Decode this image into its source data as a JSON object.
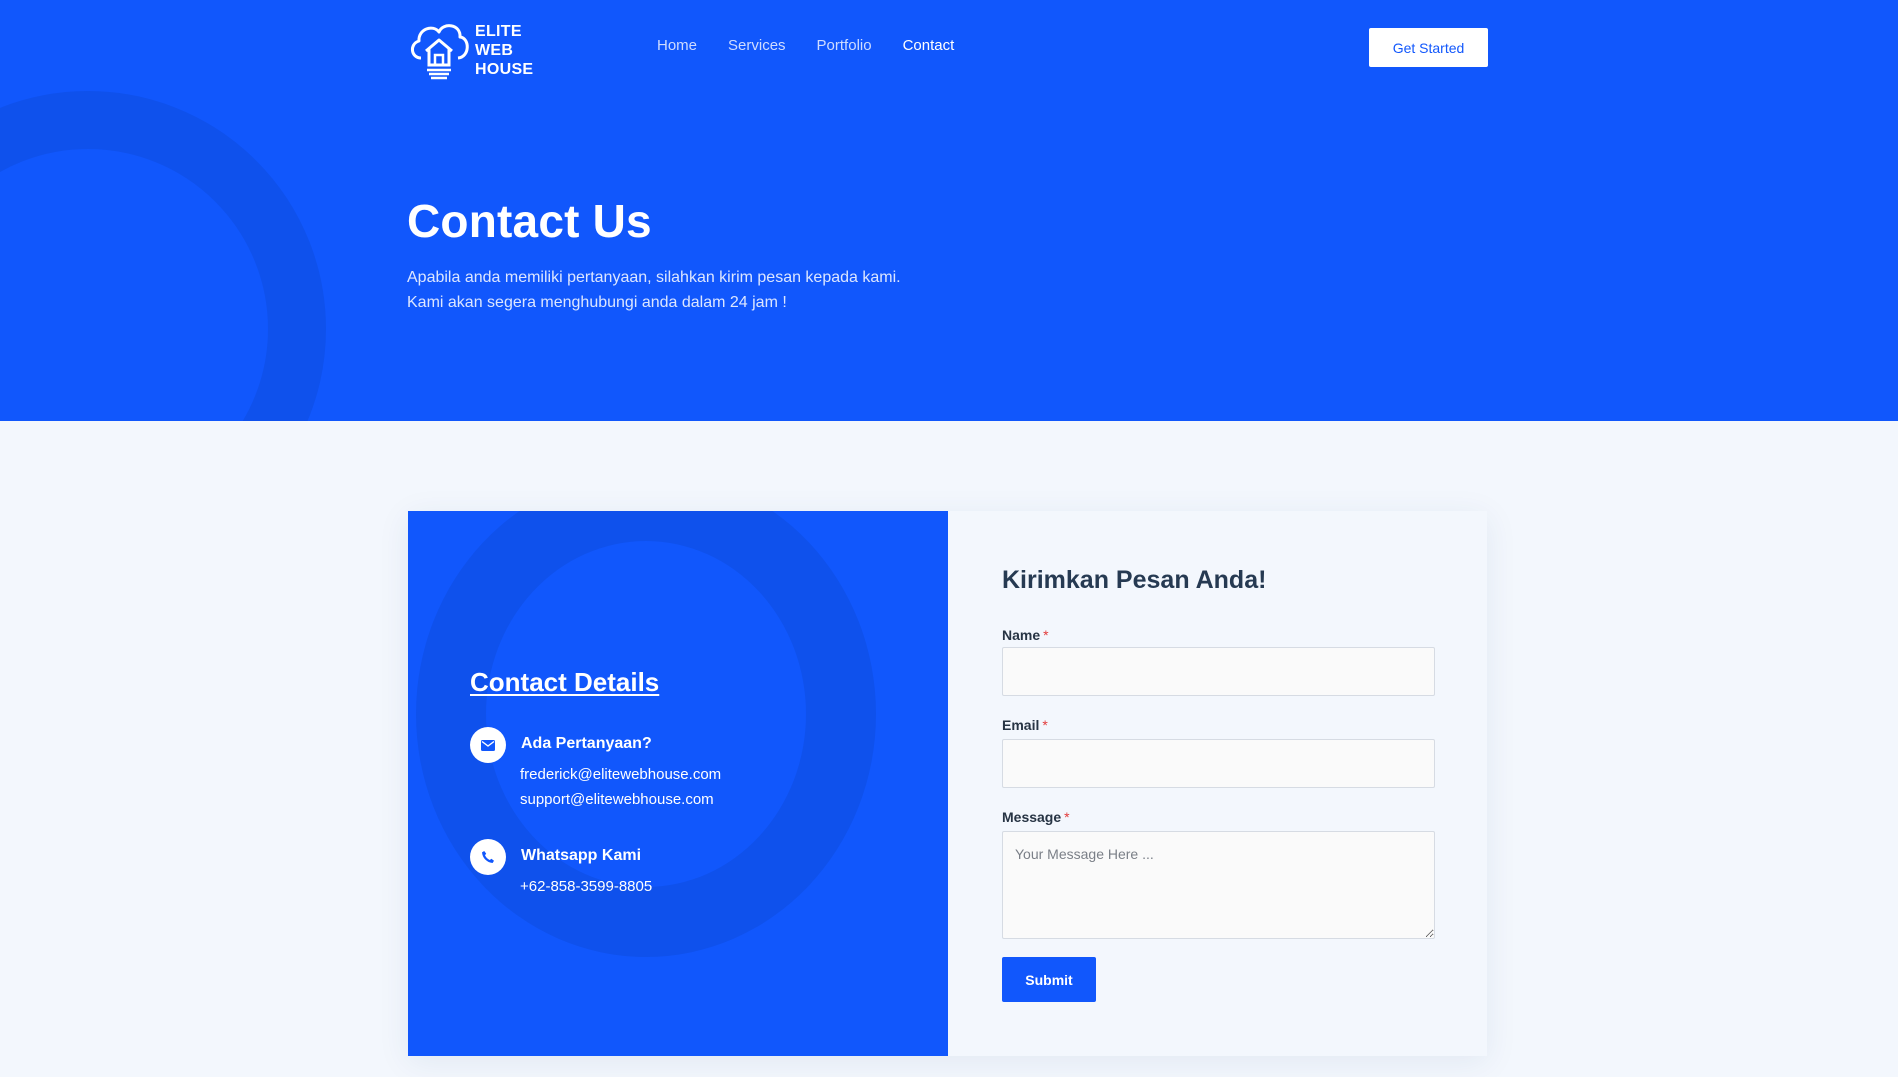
{
  "brand": {
    "logo_lines": [
      "ELITE",
      "WEB",
      "HOUSE"
    ]
  },
  "nav": {
    "links": [
      {
        "label": "Home"
      },
      {
        "label": "Services"
      },
      {
        "label": "Portfolio"
      },
      {
        "label": "Contact",
        "active": true
      }
    ],
    "cta_label": "Get Started"
  },
  "hero": {
    "title": "Contact Us",
    "lines": [
      "Apabila anda memiliki pertanyaan, silahkan kirim pesan kepada kami.",
      "Kami akan segera menghubungi anda dalam 24 jam !"
    ]
  },
  "contact_details": {
    "title": "Contact Details",
    "questions": {
      "icon": "envelope-icon",
      "title": "Ada Pertanyaan?",
      "emails": [
        "frederick@elitewebhouse.com",
        "support@elitewebhouse.com"
      ]
    },
    "whatsapp": {
      "icon": "phone-icon",
      "title": "Whatsapp Kami",
      "number": "+62-858-3599-8805"
    }
  },
  "form": {
    "title": "Kirimkan Pesan Anda!",
    "required_mark": "*",
    "name_label": "Name",
    "name_value": "",
    "email_label": "Email",
    "email_value": "",
    "message_label": "Message",
    "message_placeholder": "Your Message Here ...",
    "submit_label": "Submit"
  },
  "colors": {
    "primary": "#1157fc",
    "primary_dark_ring": "#0f51ec",
    "page_bg": "#f3f7fd",
    "required": "#e23a3a"
  }
}
